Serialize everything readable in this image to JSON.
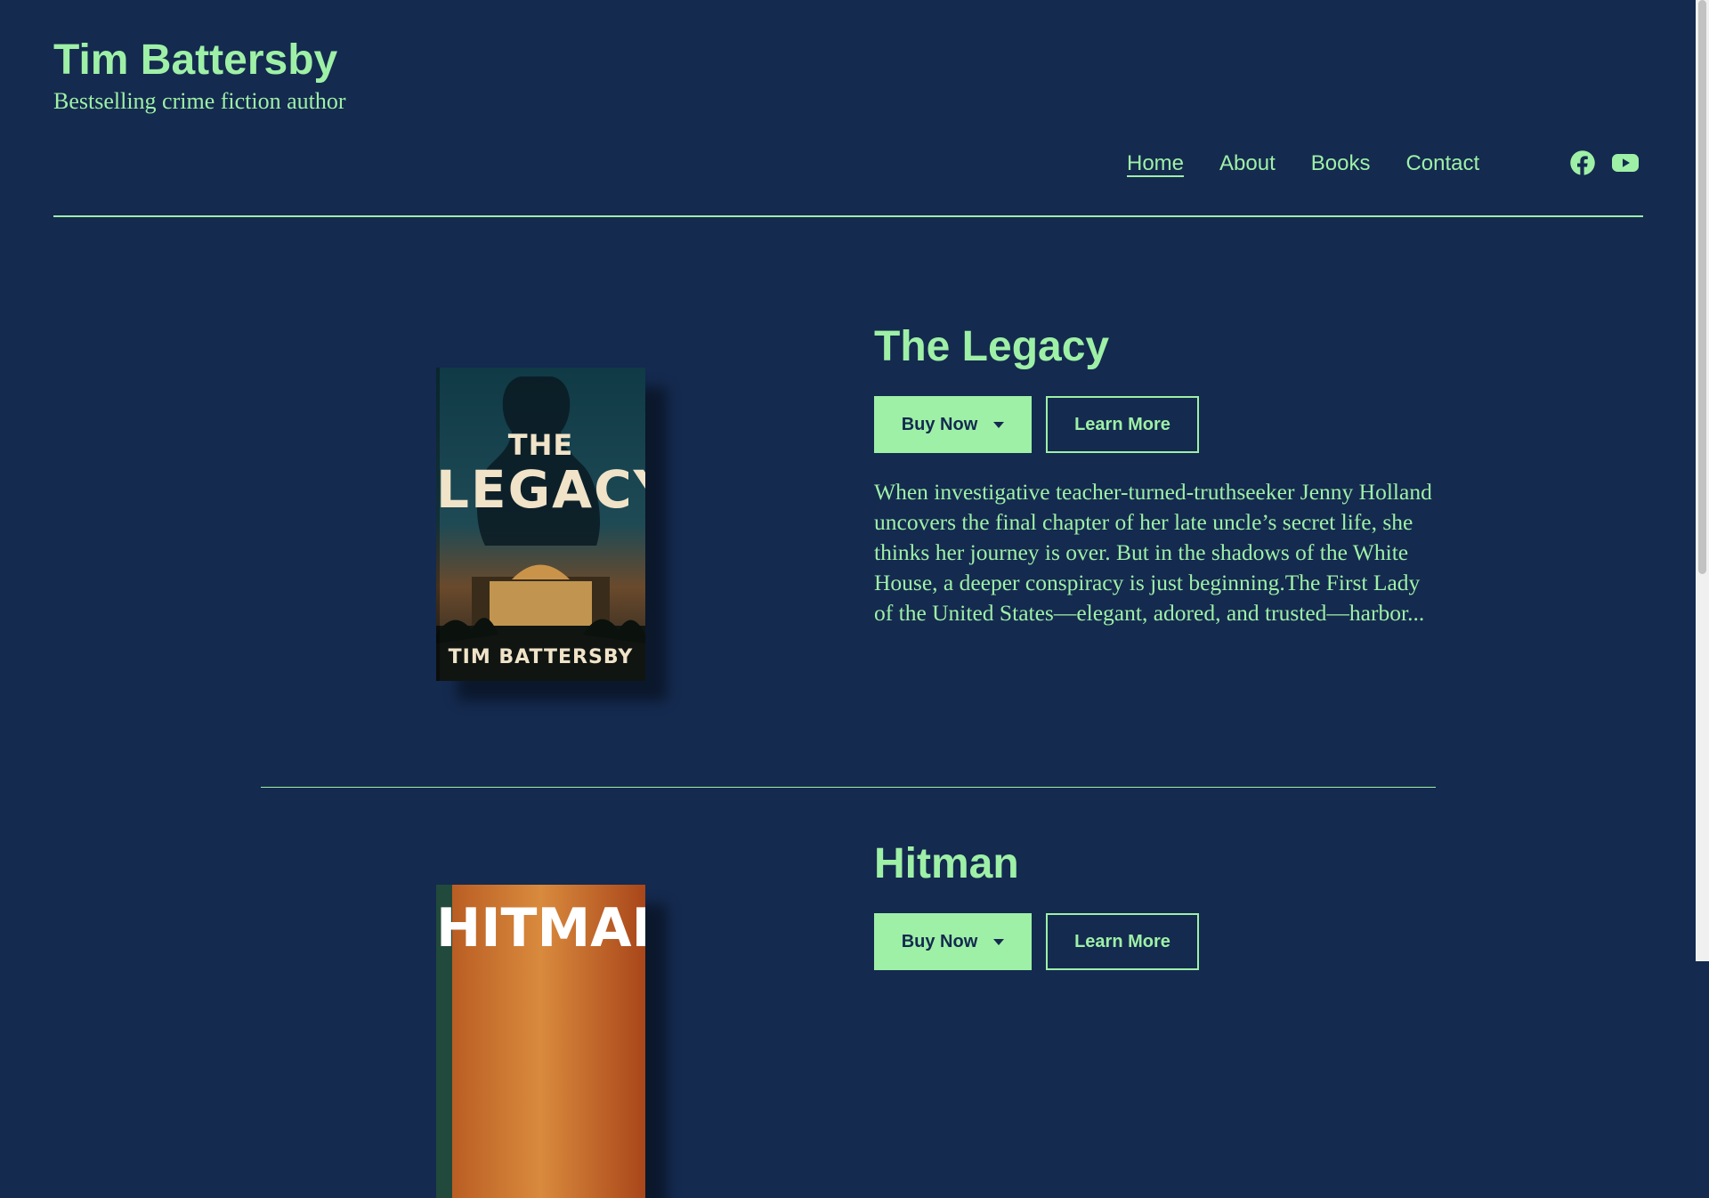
{
  "site": {
    "title": "Tim Battersby",
    "tagline": "Bestselling crime fiction author"
  },
  "nav": {
    "items": [
      "Home",
      "About",
      "Books",
      "Contact"
    ],
    "current": "Home"
  },
  "social": {
    "facebook": "facebook-icon",
    "youtube": "youtube-icon"
  },
  "colors": {
    "background": "#142a4f",
    "accent": "#9ef0a6"
  },
  "books": [
    {
      "title": "The Legacy",
      "buy_label": "Buy Now",
      "learn_label": "Learn More",
      "description": "When investigative teacher-turned-truthseeker Jenny Holland uncovers the final chapter of her late uncle’s secret life, she thinks her journey is over. But in the shadows of the White House, a deeper conspiracy is just beginning.The First Lady of the United States—elegant, adored, and trusted—harbor...",
      "cover": {
        "line1": "THE",
        "line2": "LEGACY",
        "author": "TIM BATTERSBY"
      }
    },
    {
      "title": "Hitman",
      "buy_label": "Buy Now",
      "learn_label": "Learn More",
      "cover": {
        "line1": "HITMAN"
      }
    }
  ]
}
